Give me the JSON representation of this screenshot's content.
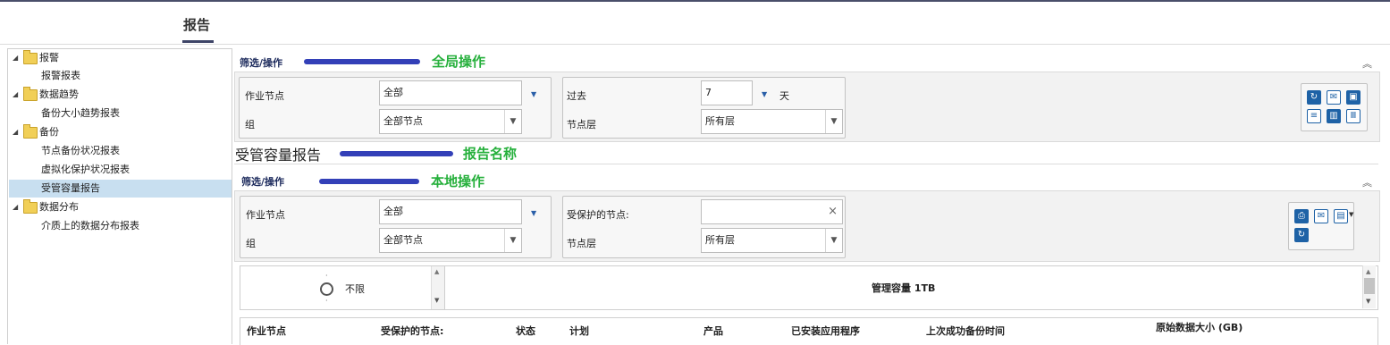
{
  "page": {
    "title": "报告"
  },
  "tree": {
    "groups": [
      {
        "label": "报警",
        "items": [
          "报警报表"
        ]
      },
      {
        "label": "数据趋势",
        "items": [
          "备份大小趋势报表"
        ]
      },
      {
        "label": "备份",
        "items": [
          "节点备份状况报表",
          "虚拟化保护状况报表",
          "受管容量报告"
        ]
      },
      {
        "label": "数据分布",
        "items": [
          "介质上的数据分布报表"
        ]
      }
    ],
    "selected": "受管容量报告"
  },
  "global": {
    "section_title": "筛选/操作",
    "annotation": "全局操作",
    "node_label": "作业节点",
    "node_value": "全部",
    "group_label": "组",
    "group_value": "全部节点",
    "past_label": "过去",
    "past_value": "7",
    "past_unit": "天",
    "layer_label": "节点层",
    "layer_value": "所有层"
  },
  "report": {
    "name": "受管容量报告",
    "annotation": "报告名称"
  },
  "local": {
    "section_title": "筛选/操作",
    "annotation": "本地操作",
    "node_label": "作业节点",
    "node_value": "全部",
    "group_label": "组",
    "group_value": "全部节点",
    "protected_label": "受保护的节点:",
    "protected_value": "",
    "layer_label": "节点层",
    "layer_value": "所有层"
  },
  "capacity": {
    "radio_label": "不限",
    "managed_capacity": "管理容量 1TB"
  },
  "table": {
    "columns": [
      "作业节点",
      "受保护的节点:",
      "状态",
      "计划",
      "产品",
      "已安装应用程序",
      "上次成功备份时间",
      "原始数据大小 (GB)"
    ]
  },
  "colors": {
    "annotation_bar": "#3340b8",
    "annotation_text": "#26b03c",
    "selected_row": "#c8dff0"
  }
}
